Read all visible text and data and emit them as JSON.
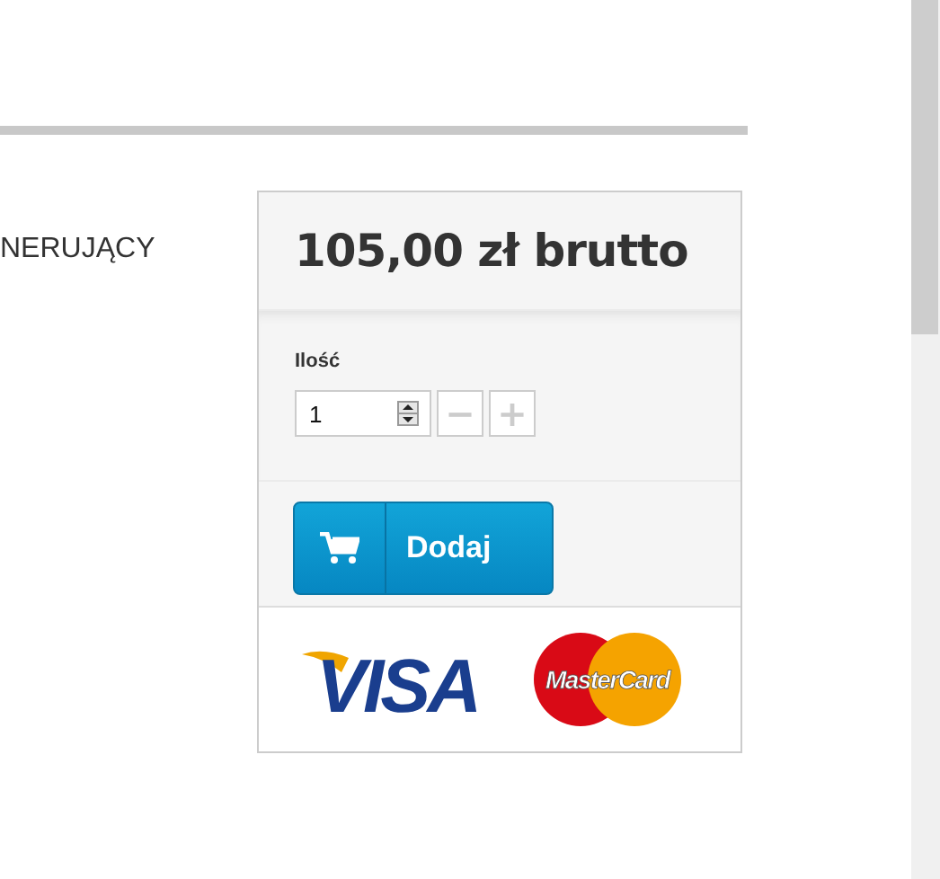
{
  "product_name_fragment": "NERUJĄCY",
  "price": "105,00 zł brutto",
  "quantity": {
    "label": "Ilość",
    "value": "1",
    "minus": "−",
    "plus": "+"
  },
  "add_button": {
    "label": "Dodaj"
  },
  "payment_logos": [
    "VISA",
    "MasterCard"
  ]
}
